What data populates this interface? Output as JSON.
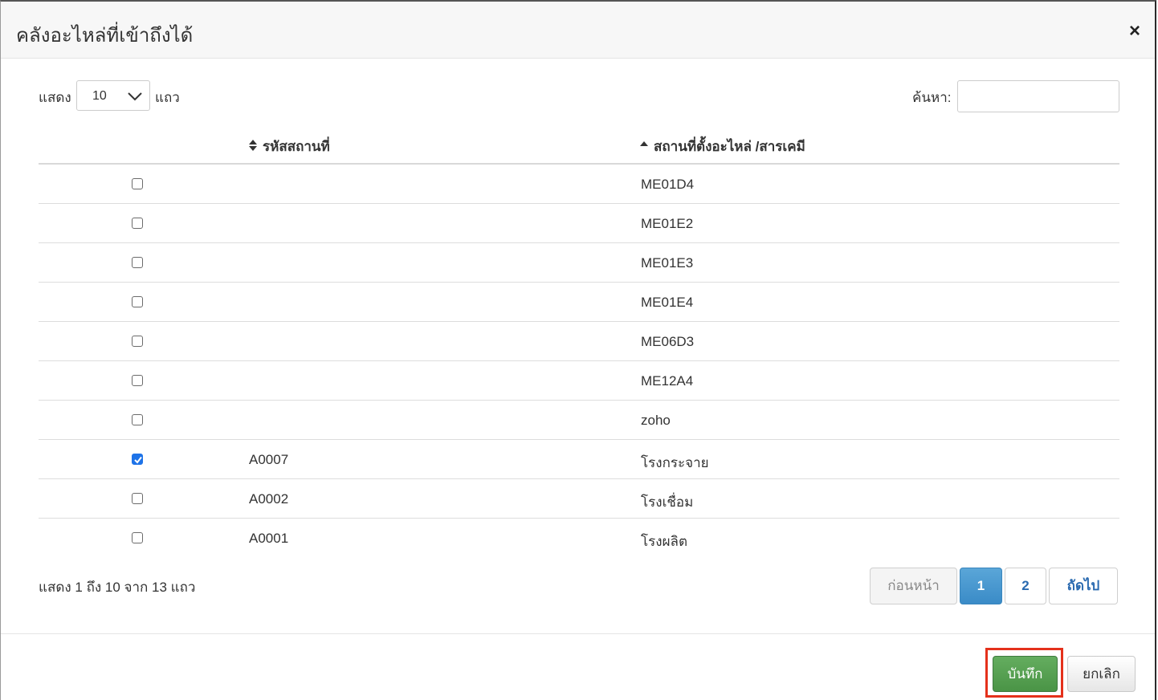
{
  "dialog": {
    "title": "คลังอะไหล่ที่เข้าถึงได้",
    "close_label": "×"
  },
  "length_control": {
    "prefix": "แสดง",
    "value": "10",
    "suffix": "แถว"
  },
  "search": {
    "label": "ค้นหา:",
    "value": "",
    "placeholder": ""
  },
  "table": {
    "columns": [
      "",
      "รหัสสถานที่",
      "สถานที่ตั้งอะไหล่ /สารเคมี"
    ],
    "rows": [
      {
        "checked": false,
        "code": "",
        "location": "ME01D4"
      },
      {
        "checked": false,
        "code": "",
        "location": "ME01E2"
      },
      {
        "checked": false,
        "code": "",
        "location": "ME01E3"
      },
      {
        "checked": false,
        "code": "",
        "location": "ME01E4"
      },
      {
        "checked": false,
        "code": "",
        "location": "ME06D3"
      },
      {
        "checked": false,
        "code": "",
        "location": "ME12A4"
      },
      {
        "checked": false,
        "code": "",
        "location": "zoho"
      },
      {
        "checked": true,
        "code": "A0007",
        "location": "โรงกระจาย"
      },
      {
        "checked": false,
        "code": "A0002",
        "location": "โรงเชื่อม"
      },
      {
        "checked": false,
        "code": "A0001",
        "location": "โรงผลิต"
      }
    ]
  },
  "info_text": "แสดง 1 ถึง 10 จาก 13 แถว",
  "pagination": {
    "prev": "ก่อนหน้า",
    "pages": [
      "1",
      "2"
    ],
    "current": "1",
    "next": "ถัดไป"
  },
  "footer": {
    "save_label": "บันทึก",
    "cancel_label": "ยกเลิก"
  },
  "colors": {
    "primary_page": "#3a8bc7",
    "save_green": "#4a9446",
    "highlight_red": "#e4311b",
    "checkbox_blue": "#1e73e8"
  }
}
